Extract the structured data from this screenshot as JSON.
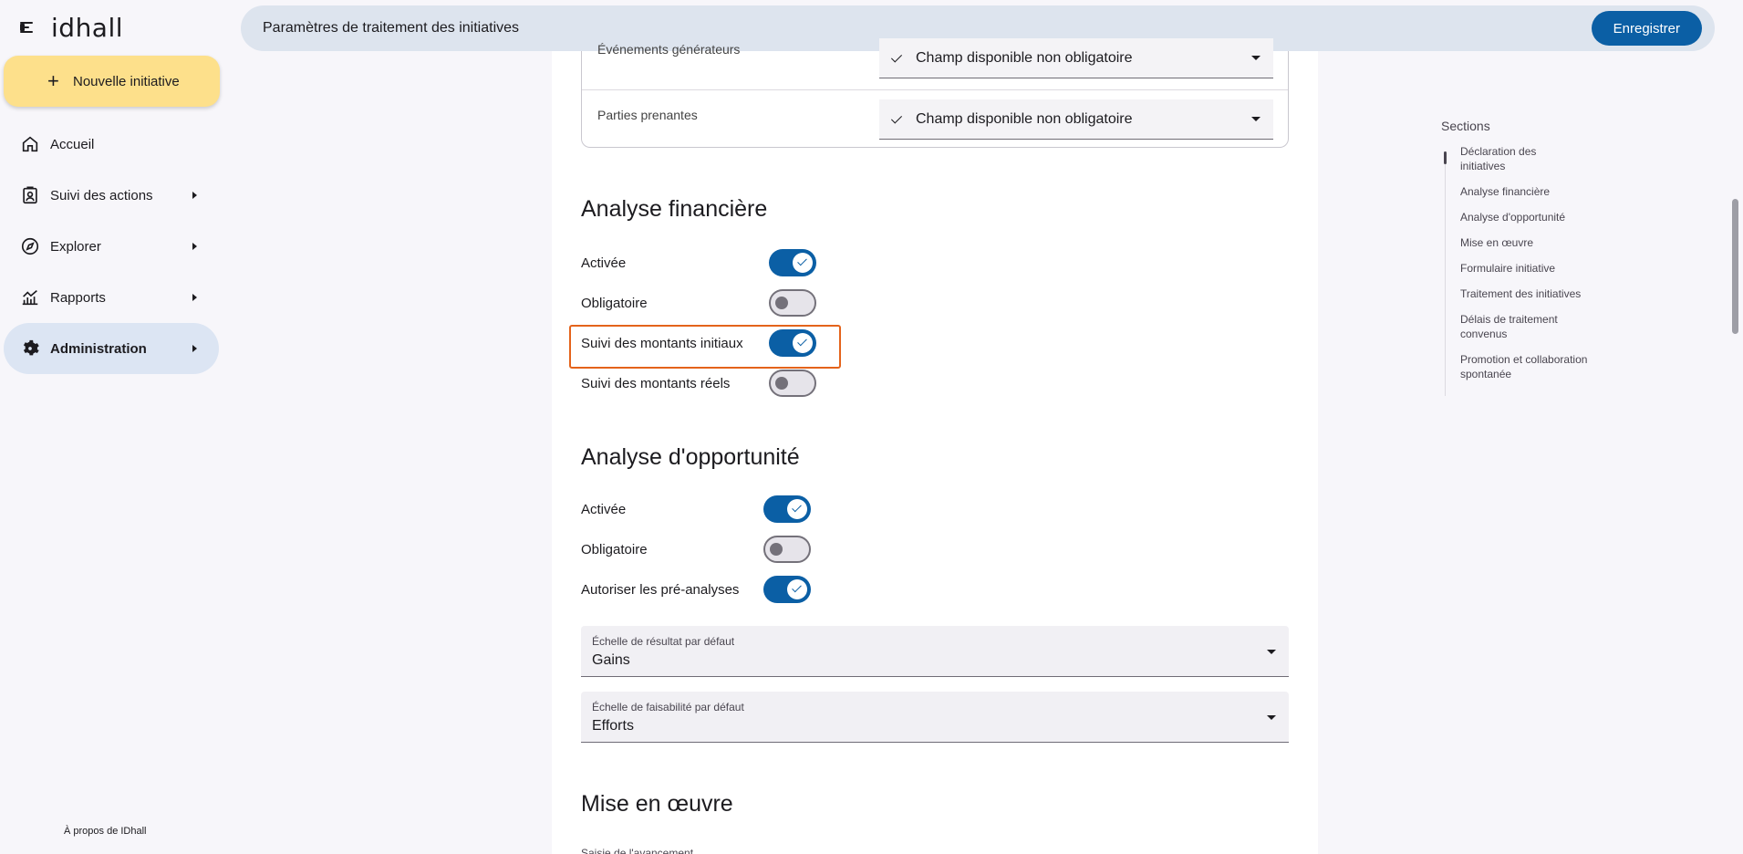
{
  "app": {
    "logo_text_prefix": "id",
    "logo_text_suffix": "hall",
    "new_initiative_label": "Nouvelle initiative",
    "about_label": "À propos de IDhall"
  },
  "sidebar": {
    "items": [
      {
        "label": "Accueil",
        "icon": "home-icon"
      },
      {
        "label": "Suivi des actions",
        "icon": "clipboard-user-icon"
      },
      {
        "label": "Explorer",
        "icon": "compass-icon"
      },
      {
        "label": "Rapports",
        "icon": "chart-line-icon"
      },
      {
        "label": "Administration",
        "icon": "gear-icon",
        "active": true
      }
    ]
  },
  "header": {
    "title": "Paramètres de traitement des initiatives",
    "save_label": "Enregistrer"
  },
  "fields": {
    "rows": [
      {
        "label": "Événements générateurs",
        "value": "Champ disponible non obligatoire"
      },
      {
        "label": "Parties prenantes",
        "value": "Champ disponible non obligatoire"
      }
    ]
  },
  "financial": {
    "title": "Analyse financière",
    "toggles": [
      {
        "label": "Activée",
        "on": true
      },
      {
        "label": "Obligatoire",
        "on": false
      },
      {
        "label": "Suivi des montants initiaux",
        "on": true
      },
      {
        "label": "Suivi des montants réels",
        "on": false
      }
    ]
  },
  "opportunity": {
    "title": "Analyse d'opportunité",
    "toggles": [
      {
        "label": "Activée",
        "on": true
      },
      {
        "label": "Obligatoire",
        "on": false
      },
      {
        "label": "Autoriser les pré-analyses",
        "on": true
      }
    ],
    "result_scale_label": "Échelle de résultat par défaut",
    "result_scale_value": "Gains",
    "feasibility_scale_label": "Échelle de faisabilité par défaut",
    "feasibility_scale_value": "Efforts"
  },
  "implementation": {
    "title": "Mise en œuvre",
    "progress_label": "Saisie de l'avancement"
  },
  "toc": {
    "title": "Sections",
    "items": [
      "Déclaration des initiatives",
      "Analyse financière",
      "Analyse d'opportunité",
      "Mise en œuvre",
      "Formulaire initiative",
      "Traitement des initiatives",
      "Délais de traitement convenus",
      "Promotion et collaboration spontanée"
    ]
  },
  "colors": {
    "primary": "#0b5fa5",
    "highlight": "#e4631b",
    "new_button": "#fde08b",
    "nav_active": "#dce5f3"
  }
}
